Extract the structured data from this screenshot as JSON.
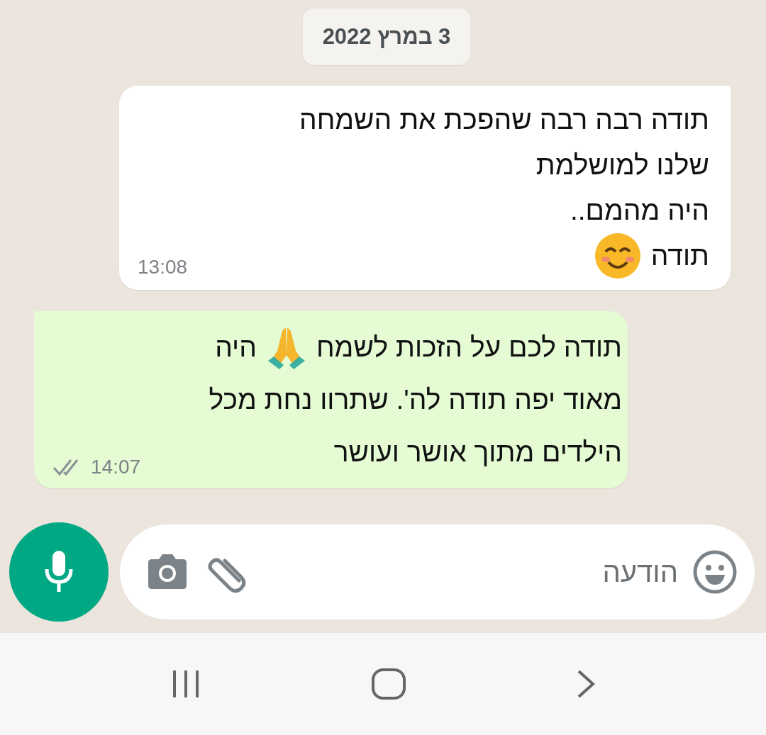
{
  "date_chip": "3 במרץ 2022",
  "messages": [
    {
      "outgoing": false,
      "time": "13:08",
      "lines": [
        [
          {
            "kind": "text",
            "text": "תודה רבה רבה שהפכת את השמחה"
          }
        ],
        [
          {
            "kind": "text",
            "text": "שלנו למושלמת"
          }
        ],
        [
          {
            "kind": "text",
            "text": "היה מהמם.."
          }
        ],
        [
          {
            "kind": "text",
            "text": "תודה"
          },
          {
            "kind": "smile"
          }
        ]
      ]
    },
    {
      "outgoing": true,
      "time": "14:07",
      "read": false,
      "lines": [
        [
          {
            "kind": "text",
            "text": "תודה לכם על הזכות לשמח"
          },
          {
            "kind": "pray"
          },
          {
            "kind": "text",
            "text": "היה"
          }
        ],
        [
          {
            "kind": "text",
            "text": "מאוד יפה תודה לה'. שתרוו נחת מכל"
          }
        ],
        [
          {
            "kind": "text",
            "text": "הילדים מתוך אושר ועושר"
          }
        ]
      ]
    }
  ],
  "composer": {
    "placeholder": "הודעה"
  }
}
